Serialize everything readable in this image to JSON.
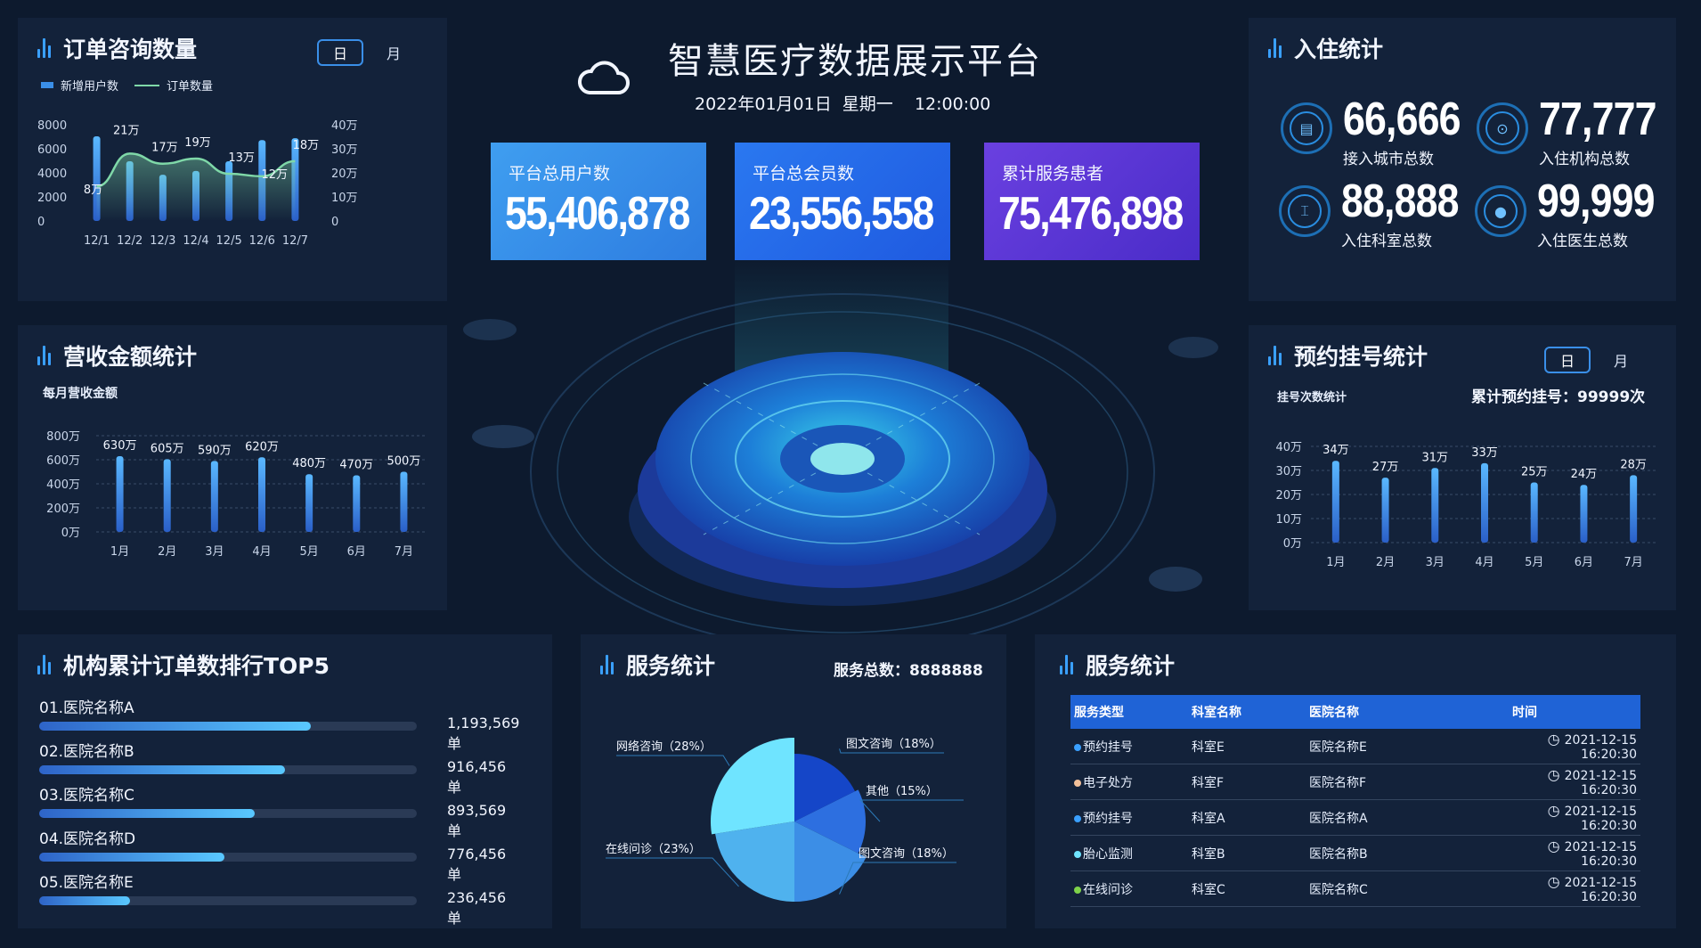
{
  "header": {
    "title": "智慧医疗数据展示平台",
    "datetime": "2022年01月01日  星期一    12:00:00"
  },
  "kpis": [
    {
      "label": "平台总用户数",
      "value": "55,406,878",
      "color": "#3a8fe8"
    },
    {
      "label": "平台总会员数",
      "value": "23,556,558",
      "color": "#2466e8"
    },
    {
      "label": "累计服务患者",
      "value": "75,476,898",
      "color": "#5238d8"
    }
  ],
  "order_panel": {
    "title": "订单咨询数量",
    "toggle": {
      "day": "日",
      "month": "月"
    },
    "legend": {
      "users": "新增用户数",
      "orders": "订单数量"
    },
    "chart_data": {
      "type": "bar",
      "categories": [
        "12/1",
        "12/2",
        "12/3",
        "12/4",
        "12/5",
        "12/6",
        "12/7"
      ],
      "series": [
        {
          "name": "新增用户数",
          "values": [
            8,
            21,
            17,
            19,
            13,
            12,
            18
          ]
        }
      ],
      "left_ticks": [
        "8000",
        "6000",
        "4000",
        "2000",
        "0"
      ],
      "right_ticks": [
        "40万",
        "30万",
        "20万",
        "10万",
        "0"
      ],
      "bar_labels": [
        "8万",
        "21万",
        "17万",
        "19万",
        "13万",
        "12万",
        "18万"
      ],
      "line_labels": [
        "8万",
        "21万",
        "17万",
        "19万",
        "13万",
        "12万",
        "18万"
      ],
      "ylim": [
        0,
        8000
      ]
    }
  },
  "revenue_panel": {
    "title": "营收金额统计",
    "subtitle": "每月营收金额",
    "chart_data": {
      "type": "bar",
      "categories": [
        "1月",
        "2月",
        "3月",
        "4月",
        "5月",
        "6月",
        "7月"
      ],
      "values": [
        630,
        605,
        590,
        620,
        480,
        470,
        500
      ],
      "labels": [
        "630万",
        "605万",
        "590万",
        "620万",
        "480万",
        "470万",
        "500万"
      ],
      "yticks": [
        "800万",
        "600万",
        "400万",
        "200万",
        "0万"
      ],
      "ylim": [
        0,
        800
      ]
    }
  },
  "checkin_panel": {
    "title": "入住统计",
    "stats": [
      {
        "value": "66,666",
        "caption": "接入城市总数",
        "icon": "building-icon"
      },
      {
        "value": "77,777",
        "caption": "入住机构总数",
        "icon": "location-pin-icon"
      },
      {
        "value": "88,888",
        "caption": "入住科室总数",
        "icon": "bed-icon"
      },
      {
        "value": "99,999",
        "caption": "入住医生总数",
        "icon": "user-icon"
      }
    ]
  },
  "appointment_panel": {
    "title": "预约挂号统计",
    "toggle": {
      "day": "日",
      "month": "月"
    },
    "subtitle": "挂号次数统计",
    "total": "累计预约挂号：99999次",
    "chart_data": {
      "type": "bar",
      "categories": [
        "1月",
        "2月",
        "3月",
        "4月",
        "5月",
        "6月",
        "7月"
      ],
      "values": [
        34,
        27,
        31,
        33,
        25,
        24,
        28
      ],
      "labels": [
        "34万",
        "27万",
        "31万",
        "33万",
        "25万",
        "24万",
        "28万"
      ],
      "yticks": [
        "40万",
        "30万",
        "20万",
        "10万",
        "0万"
      ],
      "ylim": [
        0,
        40
      ]
    }
  },
  "ranking_panel": {
    "title": "机构累计订单数排行TOP5",
    "rows": [
      {
        "name": "01.医院名称A",
        "value": "1,193,569单",
        "fraction": 0.72
      },
      {
        "name": "02.医院名称B",
        "value": "916,456单",
        "fraction": 0.65
      },
      {
        "name": "03.医院名称C",
        "value": "893,569单",
        "fraction": 0.57
      },
      {
        "name": "04.医院名称D",
        "value": "776,456单",
        "fraction": 0.49
      },
      {
        "name": "05.医院名称E",
        "value": "236,456单",
        "fraction": 0.24
      }
    ]
  },
  "service_pie_panel": {
    "title": "服务统计",
    "total": "服务总数：8888888",
    "chart_data": {
      "type": "pie",
      "slices": [
        {
          "label": "网络咨询（28%）",
          "value": 28,
          "color": "#6fe4ff"
        },
        {
          "label": "图文咨询（18%）",
          "value": 18,
          "color": "#1546c8"
        },
        {
          "label": "其他（15%）",
          "value": 15,
          "color": "#2d6fe0"
        },
        {
          "label": "图文咨询（18%）",
          "value": 18,
          "color": "#3c8ee6"
        },
        {
          "label": "在线问诊（23%）",
          "value": 23,
          "color": "#4fb2ee"
        }
      ]
    }
  },
  "service_table_panel": {
    "title": "服务统计",
    "columns": [
      "服务类型",
      "科室名称",
      "医院名称",
      "时间"
    ],
    "rows": [
      {
        "type": "预约挂号",
        "dept": "科室E",
        "hospital": "医院名称E",
        "time": "2021-12-15 16:20:30",
        "dot": "#3aa0ff"
      },
      {
        "type": "电子处方",
        "dept": "科室F",
        "hospital": "医院名称F",
        "time": "2021-12-15 16:20:30",
        "dot": "#f2c09a"
      },
      {
        "type": "预约挂号",
        "dept": "科室A",
        "hospital": "医院名称A",
        "time": "2021-12-15 16:20:30",
        "dot": "#3aa0ff"
      },
      {
        "type": "胎心监测",
        "dept": "科室B",
        "hospital": "医院名称B",
        "time": "2021-12-15 16:20:30",
        "dot": "#6fe4ff"
      },
      {
        "type": "在线问诊",
        "dept": "科室C",
        "hospital": "医院名称C",
        "time": "2021-12-15 16:20:30",
        "dot": "#7ed24a"
      }
    ]
  }
}
